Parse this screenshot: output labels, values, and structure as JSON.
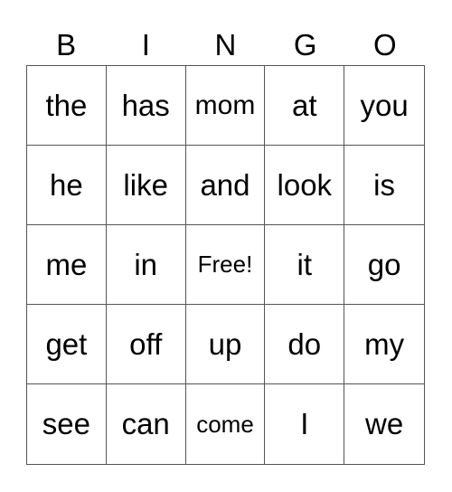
{
  "header": [
    "B",
    "I",
    "N",
    "G",
    "O"
  ],
  "cells": [
    [
      "the",
      "has",
      "mom",
      "at",
      "you"
    ],
    [
      "he",
      "like",
      "and",
      "look",
      "is"
    ],
    [
      "me",
      "in",
      "Free!",
      "it",
      "go"
    ],
    [
      "get",
      "off",
      "up",
      "do",
      "my"
    ],
    [
      "see",
      "can",
      "come",
      "I",
      "we"
    ]
  ]
}
